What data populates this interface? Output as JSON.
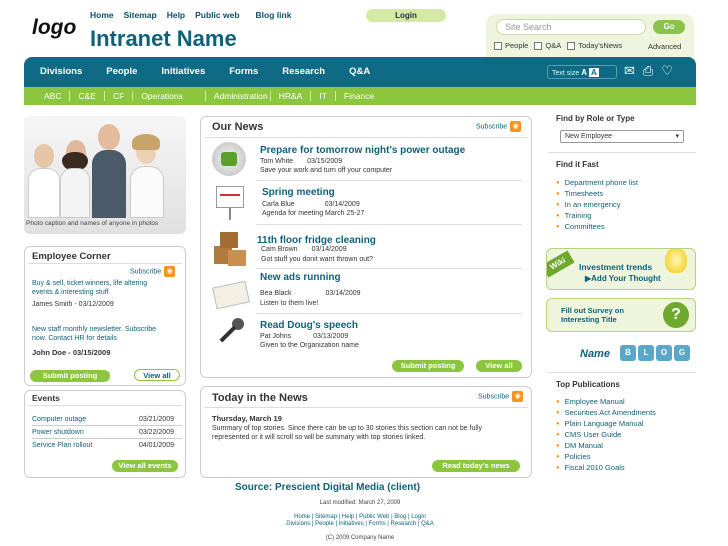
{
  "brand": {
    "logo": "logo",
    "title": "Intranet Name"
  },
  "topnav": [
    "Home",
    "Sitemap",
    "Help",
    "Public web",
    "Blog link"
  ],
  "login": "Login",
  "search": {
    "placeholder": "Site Search",
    "go": "Go",
    "options": [
      "People",
      "Q&A",
      "Today'sNews"
    ],
    "advanced": "Advanced"
  },
  "mainnav": [
    "Divisions",
    "People",
    "Initiatives",
    "Forms",
    "Research",
    "Q&A"
  ],
  "textsize": {
    "label": "Text size",
    "a": "A",
    "bigA": "A"
  },
  "subnav": [
    "ABC",
    "C&E",
    "CF",
    "Operations",
    "Administration",
    "HR&A",
    "IT",
    "Finance"
  ],
  "photo_caption": "Photo caption and names of anyone in photos",
  "employee_corner": {
    "title": "Employee Corner",
    "subscribe": "Subscribe",
    "post1": "Buy & sell, ticket winners, life altering events & interesting stuff",
    "author1": "James Smith - 03/12/2009",
    "post2": "New staff monthly newsletter. Subscribe now. Contact HR for details",
    "author2": "John Doe - 03/15/2009",
    "submit": "Submit posting",
    "viewall": "View all"
  },
  "events": {
    "title": "Events",
    "items": [
      {
        "name": "Computer outage",
        "date": "03/21/2009"
      },
      {
        "name": "Power shutdown",
        "date": "03/22/2009"
      },
      {
        "name": "Service Plan rollout",
        "date": "04/01/2009"
      }
    ],
    "viewall": "View all events"
  },
  "our_news": {
    "title": "Our News",
    "subscribe": "Subscribe",
    "items": [
      {
        "title": "Prepare for tomorrow night's power outage",
        "author": "Tom White",
        "date": "03/15/2009",
        "desc": "Save your work and turn off your computer"
      },
      {
        "title": "Spring meeting",
        "author": "Carla Blue",
        "date": "03/14/2009",
        "desc": "Agenda for meeting March 25-27"
      },
      {
        "title": "11th floor fridge cleaning",
        "author": "Cam Brown",
        "date": "03/14/2009",
        "desc": "Got stuff you donit want thrown out?"
      },
      {
        "title": "New  ads running",
        "author": "Bea Black",
        "date": "03/14/2009",
        "desc": "Listen to them live!"
      },
      {
        "title": "Read Doug's speech",
        "author": "Pat Johns",
        "date": "03/13/2009",
        "desc": "Given to the Organization name"
      }
    ],
    "submit": "Submit posting",
    "viewall": "View all"
  },
  "today_news": {
    "title": "Today in the News",
    "subscribe": "Subscribe",
    "date": "Thursday, March 19",
    "text": "Summary of top stories. Since there can be up to 30 stories this section can not be fully represented or it will scroll so will be summary with top stories linked.",
    "read": "Read today's news"
  },
  "source": "Source: Prescient Digital Media (client)",
  "footer": {
    "modified": "Last modified: March 27, 2009",
    "links1": "Home | Sitemap | Help | Public Web | Blog | Login",
    "links2": "Divisions | People | Initiatives | Forms | Research | Q&A",
    "copy": "(C) 2009 Company Name"
  },
  "role": {
    "title": "Find by Role or Type",
    "select": "New Employee"
  },
  "findfast": {
    "title": "Find it Fast",
    "items": [
      "Department phone list",
      "Timesheets",
      "In an emergency",
      "Training",
      "Committees"
    ]
  },
  "wiki": {
    "tag": "Wiki",
    "title": "Investment trends",
    "add": "Add Your Thought"
  },
  "survey": {
    "line1": "Fill out Survey on",
    "line2": "Interesting Title"
  },
  "blog": {
    "name": "Name",
    "letters": [
      "B",
      "L",
      "O",
      "G"
    ]
  },
  "publications": {
    "title": "Top Publications",
    "items": [
      "Employee Manual",
      "Securities Act Amendments",
      "Plain Language Manual",
      "CMS User Guide",
      "DM Manual",
      "Policies",
      "Fiscal 2010 Goals"
    ]
  }
}
